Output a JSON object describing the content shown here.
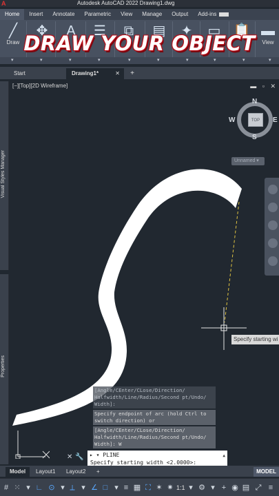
{
  "app": {
    "title": "Autodesk AutoCAD 2022    Drawing1.dwg",
    "logo_glyph": "A",
    "colors": {
      "accent": "#2e7fd9",
      "canvas": "#212830",
      "tracking": "#e0c341"
    }
  },
  "ribbon": {
    "tabs": [
      {
        "label": "Home",
        "active": true
      },
      {
        "label": "Insert"
      },
      {
        "label": "Annotate"
      },
      {
        "label": "Parametric"
      },
      {
        "label": "View"
      },
      {
        "label": "Manage"
      },
      {
        "label": "Output"
      },
      {
        "label": "Add-ins"
      }
    ],
    "tools": {
      "draw_label": "Draw",
      "view_label": "View"
    }
  },
  "overlay": {
    "headline": "DRAW YOUR OBJECT"
  },
  "doc_tabs": {
    "start": "Start",
    "active": "Drawing1*",
    "close": "✕",
    "add": "+"
  },
  "palettes": {
    "visual_styles": "Visual Styles Manager",
    "properties": "Properties"
  },
  "viewport": {
    "label": "[−][Top][2D Wireframe]",
    "controls": "▬ ▫ ✕"
  },
  "viewcube": {
    "face": "TOP",
    "north": "N",
    "south": "S",
    "east": "E",
    "west": "W",
    "ucs_menu": "Unnamed ▾"
  },
  "tooltip": "Specify starting wi",
  "command_history": [
    {
      "text": "[Angle/CEnter/CLose/Direction/\nHalfwidth/Line/Radius/Second pt/Undo/\nWidth]:",
      "dim": true
    },
    {
      "text": "Specify endpoint of arc (hold Ctrl to\nswitch direction) or",
      "dim": false
    },
    {
      "text": "[Angle/CEnter/CLose/Direction/\nHalfwidth/Line/Radius/Second pt/Undo/\nWidth]: W",
      "dim": false
    }
  ],
  "command_line": {
    "prompt_prefix": "▸ ▾",
    "command": "PLINE",
    "prompt": "Specify starting width <2.0000>:",
    "scroll": "▲"
  },
  "layout_tabs": {
    "model": "Model",
    "layout1": "Layout1",
    "layout2": "Layout2",
    "add": "+",
    "space_badge": "MODEL"
  },
  "status_bar": {
    "scale": "1:1"
  }
}
